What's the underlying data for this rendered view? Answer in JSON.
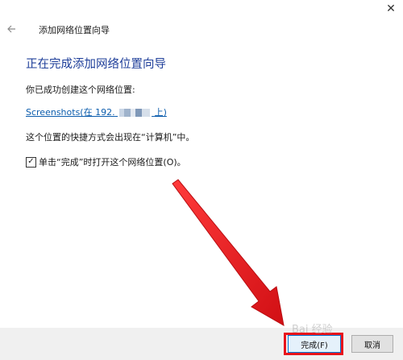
{
  "window": {
    "close_glyph": "✕"
  },
  "wizard": {
    "title": "添加网络位置向导"
  },
  "content": {
    "heading": "正在完成添加网络位置向导",
    "created_label": "你已成功创建这个网络位置:",
    "location_link_prefix": "Screenshots(在 192.",
    "location_link_suffix": "上)",
    "shortcut_note": "这个位置的快捷方式会出现在“计算机”中。",
    "checkbox_label": "单击“完成”时打开这个网络位置(O)。",
    "checkbox_checked": true,
    "checkbox_glyph": "✓"
  },
  "buttons": {
    "finish": "完成(F)",
    "cancel": "取消"
  },
  "annotation": {
    "highlight_color": "#e8141b",
    "arrow_color": "#e8141b"
  },
  "watermark": {
    "text": "Bai 经验"
  },
  "icons": {
    "back": "back-arrow-icon",
    "close": "close-icon"
  }
}
